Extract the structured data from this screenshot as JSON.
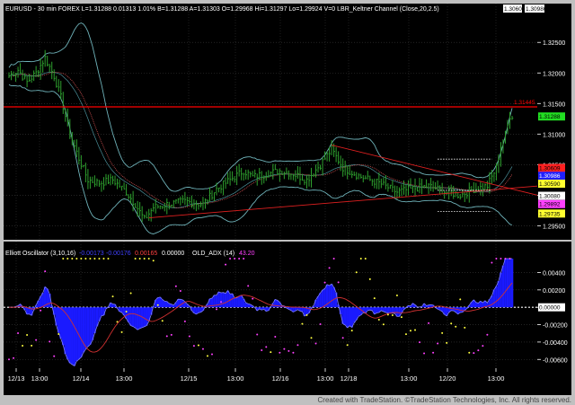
{
  "window": {
    "footer": "Created with TradeStation. ©TradeStation Technologies, Inc. All rights reserved."
  },
  "colors": {
    "background": "#000000",
    "price_bar": "#2ea02e",
    "channel": "#6fb3ba",
    "ema": "#d05050",
    "resistance": "#ff0000",
    "trendline": "#e02020",
    "osc_fill": "#1a1aff",
    "osc_line": "#8080ff",
    "adx_line": "#d03030",
    "adx_dot_magenta": "#ff40ff",
    "adx_dot_yellow": "#ffff40",
    "bubble_green": "#22dd22",
    "bubble_red": "#ff2020",
    "bubble_yellow": "#ffff30",
    "bubble_white": "#ffffff",
    "bubble_blue": "#2020ff"
  },
  "header": {
    "text": "EURUSD - 30 min  FOREX  L=1.31288  0.01313  1.01%  B=1.31288  A=1.31303  O=1.29968  Hi=1.31297  Lo=1.29924  V=0  LBR_Keltner Channel (Close,20,2.5)",
    "right_values": [
      "1.30609",
      "1.30986"
    ]
  },
  "osc_header": {
    "name": "Elliott Oscillator (3,10,16)",
    "v1": "-0.00173",
    "v2": "-0.00176",
    "v3": "0.00165",
    "v4": "0.00000",
    "adx_name": "OLD_ADX (14)",
    "adx_val": "43.20"
  },
  "chart_data": {
    "type": "line",
    "title": "EURUSD - 30 min",
    "price_axis": {
      "ylim": [
        1.293,
        1.329
      ],
      "ticks": [
        "1.32500",
        "1.32000",
        "1.31500",
        "1.31000",
        "1.30500",
        "1.30000",
        "1.29500"
      ],
      "tick_values": [
        1.325,
        1.32,
        1.315,
        1.31,
        1.305,
        1.3,
        1.295
      ]
    },
    "x_labels": [
      "12/13",
      "13:00",
      "12/14",
      "13:00",
      "12/15",
      "13:00",
      "12/16",
      "13:00",
      "12/18",
      "13:00",
      "12/20",
      "13:00"
    ],
    "close_anchors": [
      [
        0,
        1.3195
      ],
      [
        4,
        1.3205
      ],
      [
        8,
        1.3185
      ],
      [
        12,
        1.32
      ],
      [
        16,
        1.3225
      ],
      [
        20,
        1.3195
      ],
      [
        23,
        1.316
      ],
      [
        27,
        1.31
      ],
      [
        31,
        1.306
      ],
      [
        35,
        1.3025
      ],
      [
        40,
        1.302
      ],
      [
        46,
        1.3025
      ],
      [
        52,
        1.3005
      ],
      [
        56,
        1.2985
      ],
      [
        60,
        1.296
      ],
      [
        64,
        1.298
      ],
      [
        70,
        1.2985
      ],
      [
        78,
        1.299
      ],
      [
        86,
        1.2985
      ],
      [
        92,
        1.301
      ],
      [
        98,
        1.3025
      ],
      [
        104,
        1.304
      ],
      [
        108,
        1.303
      ],
      [
        114,
        1.3035
      ],
      [
        120,
        1.304
      ],
      [
        126,
        1.3035
      ],
      [
        132,
        1.3025
      ],
      [
        138,
        1.305
      ],
      [
        143,
        1.3075
      ],
      [
        148,
        1.3045
      ],
      [
        156,
        1.303
      ],
      [
        164,
        1.302
      ],
      [
        172,
        1.3005
      ],
      [
        178,
        1.301
      ],
      [
        186,
        1.3015
      ],
      [
        194,
        1.3005
      ],
      [
        200,
        1.3
      ],
      [
        206,
        1.301
      ],
      [
        212,
        1.3015
      ],
      [
        216,
        1.3045
      ],
      [
        218,
        1.308
      ],
      [
        220,
        1.31
      ],
      [
        222,
        1.313
      ]
    ],
    "series": [
      {
        "name": "LBR_Keltner Channel (Close,20,2.5)",
        "last_values": [
          1.30986,
          1.30609
        ]
      }
    ],
    "price_labels": [
      {
        "text": "1.31445",
        "value": 1.31445,
        "bg": "#ff0000",
        "fg": "#ffffff",
        "kind": "tag"
      },
      {
        "text": "1.31288",
        "value": 1.31288,
        "bg": "#22dd22",
        "fg": "#000000",
        "kind": "bubble"
      },
      {
        "text": "1.30609",
        "value": 1.30446,
        "bg": "#ff2020",
        "fg": "#000000",
        "kind": "bubble"
      },
      {
        "text": "1.30986",
        "value": 1.30318,
        "bg": "#2020ff",
        "fg": "#ffffff",
        "kind": "bubble"
      },
      {
        "text": "1.30590",
        "value": 1.30188,
        "bg": "#ffff30",
        "fg": "#000000",
        "kind": "bubble"
      },
      {
        "text": "1.30080",
        "value": 1.2999,
        "bg": "#ffffff",
        "fg": "#000000",
        "kind": "bubble"
      },
      {
        "text": "1.29892",
        "value": 1.29855,
        "bg": "#ff40ff",
        "fg": "#000000",
        "kind": "bubble"
      },
      {
        "text": "1.29735",
        "value": 1.297,
        "bg": "#ffff30",
        "fg": "#000000",
        "kind": "bubble"
      }
    ],
    "resistance_level": 1.31445,
    "oscillator": {
      "ylim": [
        -0.0068,
        0.0056
      ],
      "ticks": [
        "0.00400",
        "0.00200",
        "0.00000",
        "-0.00200",
        "-0.00400",
        "-0.00600"
      ],
      "tick_values": [
        0.004,
        0.002,
        0.0,
        -0.002,
        -0.004,
        -0.006
      ],
      "last_value": "0.00000",
      "adx_last": 43.2
    }
  }
}
